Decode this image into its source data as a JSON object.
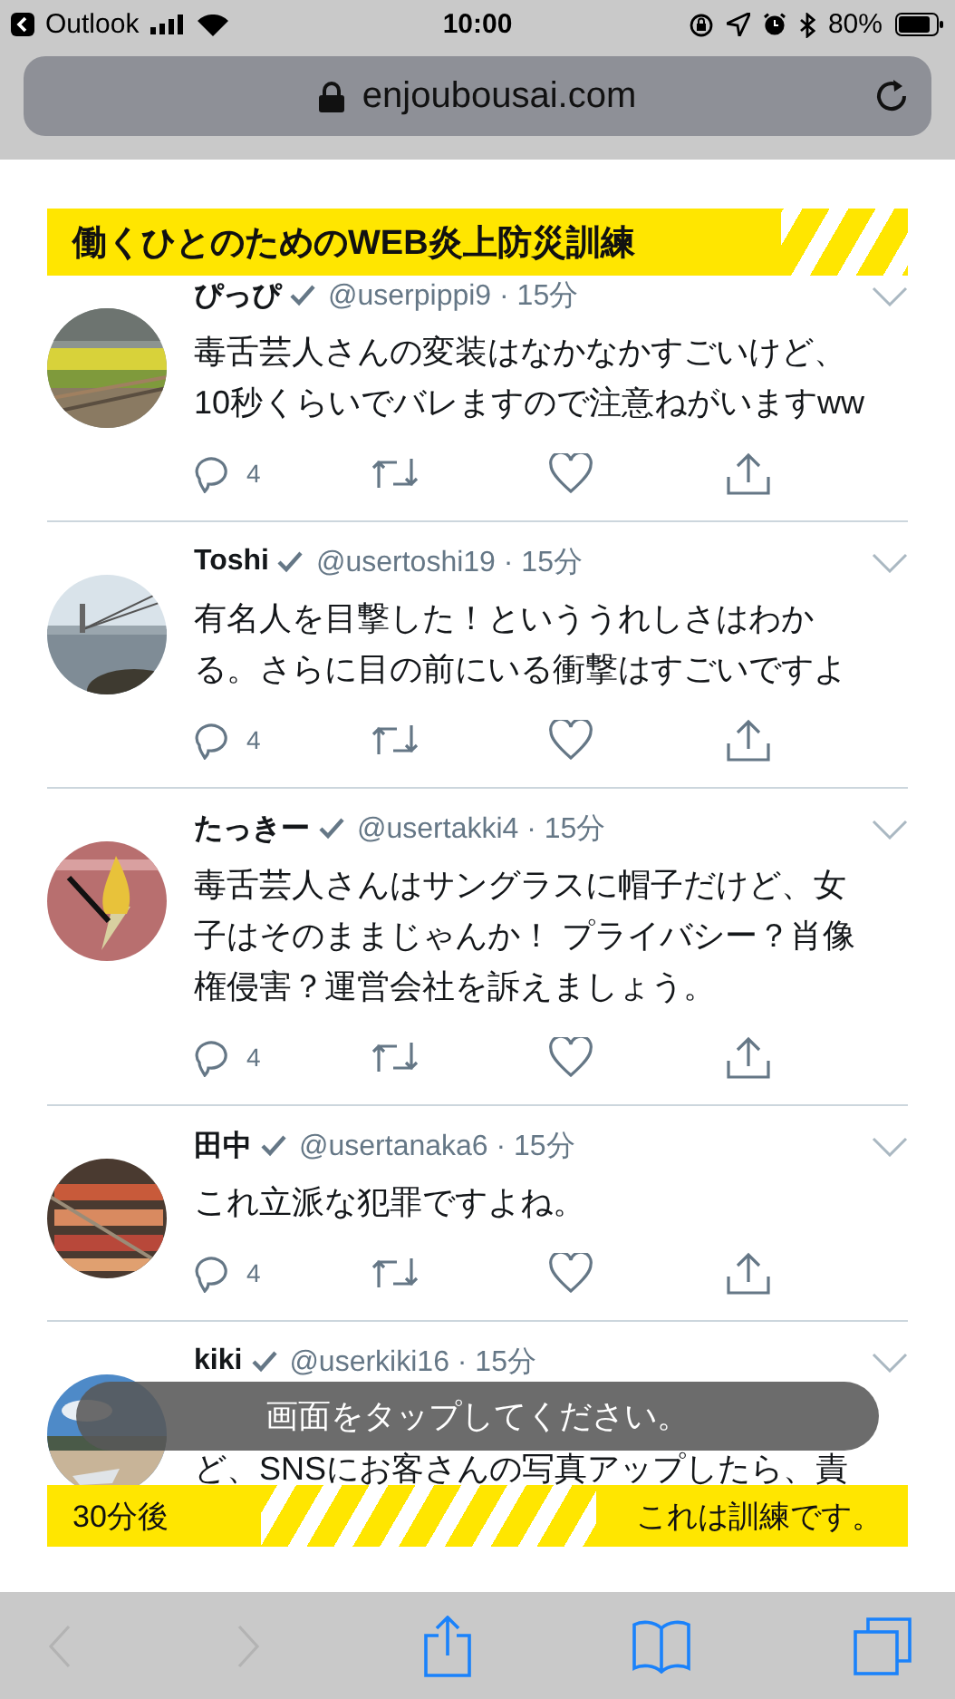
{
  "status_bar": {
    "back_app": "Outlook",
    "time": "10:00",
    "battery": "80%"
  },
  "address_bar": {
    "url": "enjoubousai.com"
  },
  "header_banner": {
    "title": "働くひとのためのWEB炎上防災訓練"
  },
  "tweets": [
    {
      "name": "ぴっぴ",
      "meta": "@userpippi9 · 15分",
      "text": "毒舌芸人さんの変装はなかなかすごいけど、10秒くらいでバレますので注意ねがいますww",
      "replies": "4"
    },
    {
      "name": "Toshi",
      "meta": "@usertoshi19 · 15分",
      "text": "有名人を目撃した！といううれしさはわかる。さらに目の前にいる衝撃はすごいですよ",
      "replies": "4"
    },
    {
      "name": "たっきー",
      "meta": "@usertakki4 · 15分",
      "text": "毒舌芸人さんはサングラスに帽子だけど、女子はそのままじゃんか！ プライバシー？肖像権侵害？運営会社を訴えましょう。",
      "replies": "4"
    },
    {
      "name": "田中",
      "meta": "@usertanaka6 · 15分",
      "text": "これ立派な犯罪ですよね。",
      "replies": "4"
    },
    {
      "name": "kiki",
      "meta": "@userkiki16 · 15分",
      "first_line_hidden": true,
      "text": "ど、SNSにお客さんの写真アップしたら、責"
    }
  ],
  "toast": {
    "text": "画面をタップしてください。"
  },
  "footer_banner": {
    "left": "30分後",
    "right": "これは訓練です。"
  },
  "toolbar": {
    "buttons": [
      {
        "kind": "back",
        "disabled": true
      },
      {
        "kind": "forward",
        "disabled": true
      },
      {
        "kind": "share",
        "disabled": false
      },
      {
        "kind": "bookmarks",
        "disabled": false
      },
      {
        "kind": "tabs",
        "disabled": false
      }
    ]
  }
}
